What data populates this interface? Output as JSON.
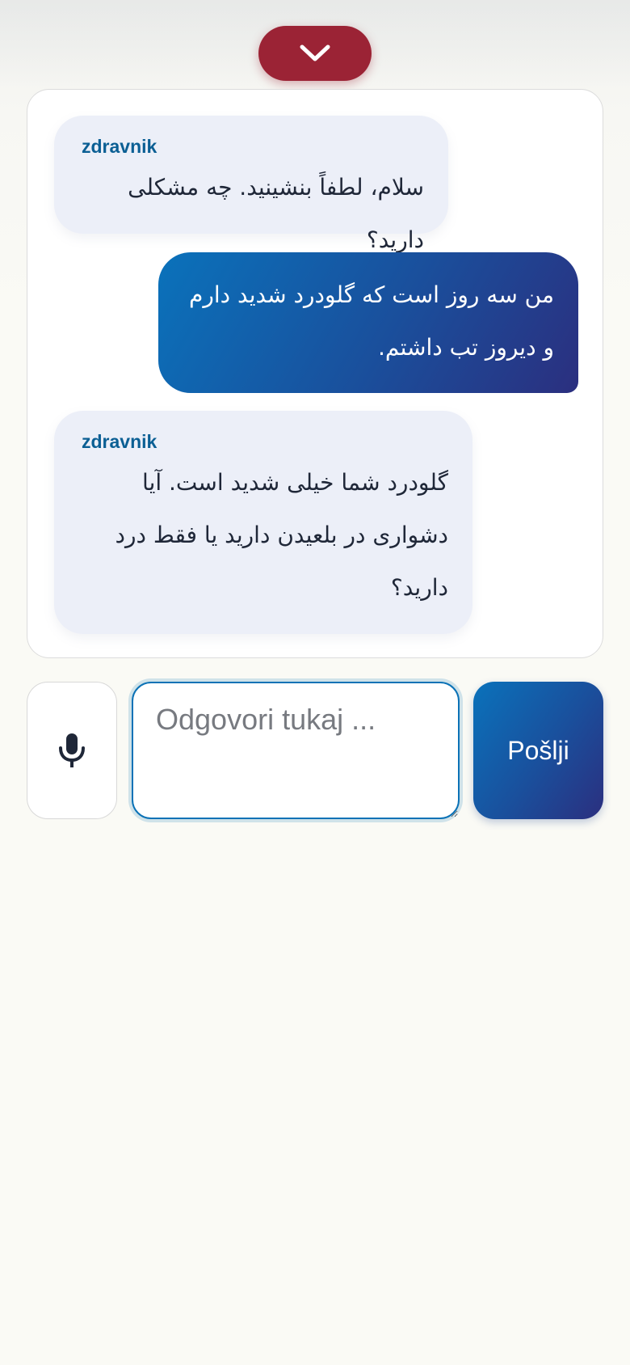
{
  "header": {
    "collapse_icon": "chevron-down-icon",
    "collapse_color": "#9b2335"
  },
  "chat": {
    "messages": [
      {
        "role": "doctor",
        "sender": "zdravnik",
        "text": "سلام، لطفاً بنشینید. چه مشکلی دارید؟"
      },
      {
        "role": "patient",
        "sender": "",
        "text": "من سه روز است که گلودرد شدید دارم و دیروز تب داشتم."
      },
      {
        "role": "doctor",
        "sender": "zdravnik",
        "text": "گلودرد شما خیلی شدید است. آیا دشواری در بلعیدن دارید یا فقط درد دارید؟"
      }
    ]
  },
  "composer": {
    "mic_icon": "microphone-icon",
    "input_placeholder": "Odgovori tukaj ...",
    "input_value": "",
    "send_label": "Pošlji"
  },
  "colors": {
    "accent_red": "#9b2335",
    "accent_blue": "#0a72bb",
    "accent_indigo": "#2b2f7f",
    "sender_label": "#0b5f94",
    "doctor_bubble": "#eceff8"
  }
}
